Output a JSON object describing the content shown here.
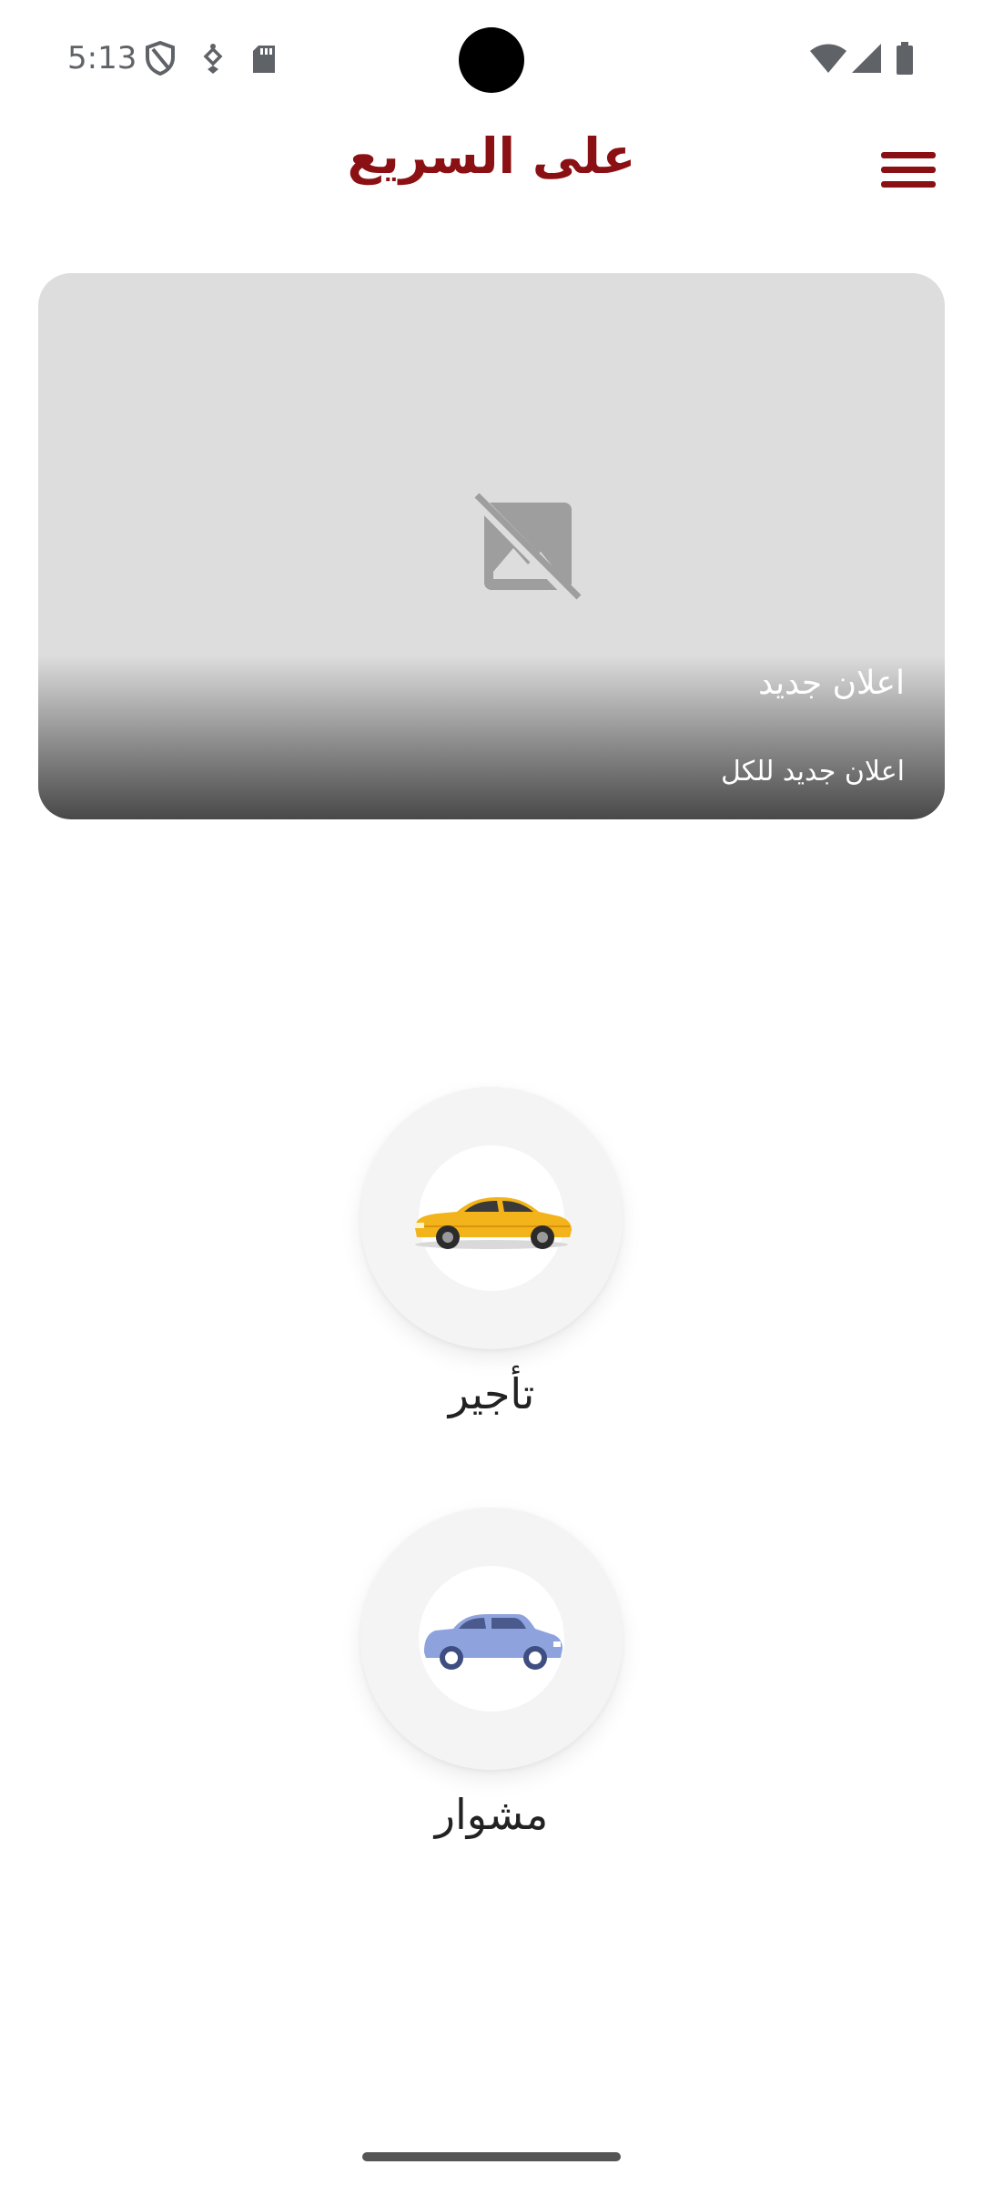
{
  "status_bar": {
    "time": "5:13",
    "left_icons": [
      "shield-icon",
      "location-pin-icon",
      "sd-card-icon"
    ],
    "right_icons": [
      "wifi-icon",
      "cellular-signal-icon",
      "battery-icon"
    ]
  },
  "app_bar": {
    "title": "على السريع",
    "menu_icon": "hamburger-menu-icon",
    "accent_color": "#8b1014"
  },
  "banner": {
    "image_icon": "broken-image-icon",
    "title": "اعلان جديد",
    "subtitle": "اعلان جديد للكل"
  },
  "services": [
    {
      "label": "تأجير",
      "icon": "yellow-sedan-car-icon"
    },
    {
      "label": "مشوار",
      "icon": "blue-hatchback-car-icon"
    }
  ]
}
